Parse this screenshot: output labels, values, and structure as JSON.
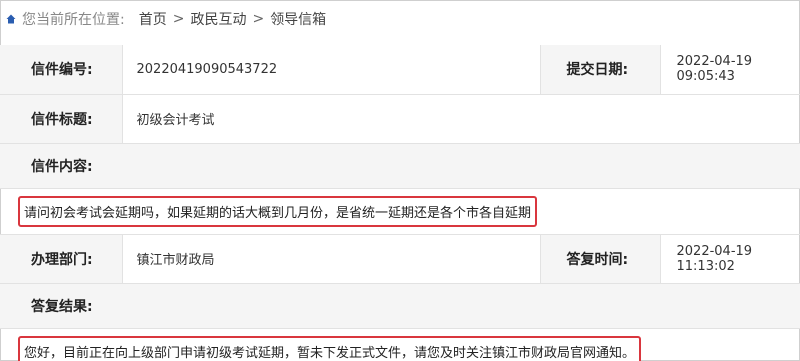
{
  "breadcrumb": {
    "home_icon": "home-icon",
    "prefix": "您当前所在位置:",
    "items": [
      "首页",
      "政民互动",
      "领导信箱"
    ],
    "separator": ">"
  },
  "letter": {
    "number_label": "信件编号:",
    "number_value": "20220419090543722",
    "submit_date_label": "提交日期:",
    "submit_date_value": "2022-04-19 09:05:43",
    "title_label": "信件标题:",
    "title_value": "初级会计考试",
    "content_label": "信件内容:",
    "content_value": "请问初会考试会延期吗，如果延期的话大概到几月份，是省统一延期还是各个市各自延期",
    "department_label": "办理部门:",
    "department_value": "镇江市财政局",
    "reply_time_label": "答复时间:",
    "reply_time_value": "2022-04-19 11:13:02",
    "result_label": "答复结果:",
    "result_value": "您好，目前正在向上级部门申请初级考试延期，暂未下发正式文件，请您及时关注镇江市财政局官网通知。"
  },
  "colors": {
    "highlight_border": "#d9363e",
    "label_bg": "#f5f5f5",
    "home_icon": "#2a5db0"
  }
}
